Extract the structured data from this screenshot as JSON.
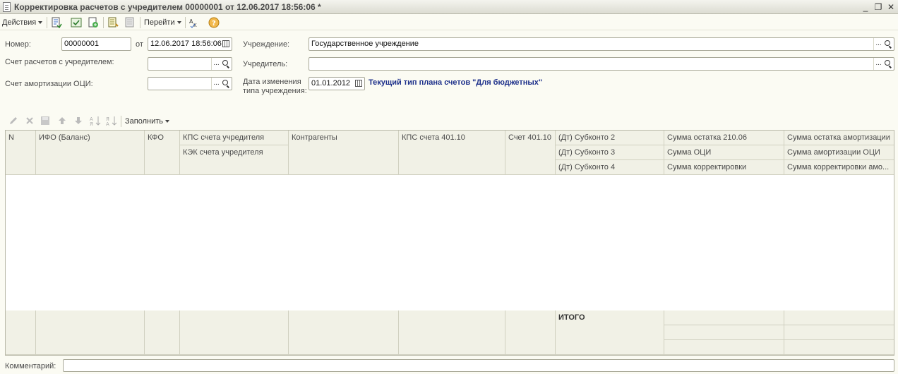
{
  "window": {
    "title": "Корректировка расчетов с учредителем 00000001 от 12.06.2017 18:56:06 *",
    "minimize_symbol": "_",
    "restore_symbol": "❐",
    "close_symbol": "✕"
  },
  "toolbar": {
    "actions_label": "Действия",
    "goto_label": "Перейти"
  },
  "form": {
    "number_label": "Номер:",
    "number_value": "00000001",
    "from_label": "от",
    "date_value": "12.06.2017 18:56:06",
    "account_label": "Счет расчетов с учредителем:",
    "account_value": "",
    "amort_label": "Счет амортизации ОЦИ:",
    "amort_value": "",
    "institution_label": "Учреждение:",
    "institution_value": "Государственное учреждение",
    "founder_label": "Учредитель:",
    "founder_value": "",
    "change_date_label_1": "Дата изменения",
    "change_date_label_2": "типа учреждения:",
    "change_date_value": "01.01.2012",
    "plan_info": "Текущий тип плана счетов \"Для бюджетных\""
  },
  "table_toolbar": {
    "fill_label": "Заполнить"
  },
  "table": {
    "headers": {
      "n": "N",
      "ifo": "ИФО (Баланс)",
      "kfo": "КФО",
      "kps_founder": "КПС счета учредителя",
      "kek_founder": "КЭК счета учредителя",
      "contractors": "Контрагенты",
      "kps_401": "КПС счета 401.10",
      "acc_401": "Счет 401.10",
      "subkonto2": "(Дт) Субконто 2",
      "subkonto3": "(Дт) Субконто 3",
      "subkonto4": "(Дт) Субконто 4",
      "sum_balance": "Сумма остатка 210.06",
      "sum_oci": "Сумма ОЦИ",
      "sum_correction": "Сумма корректировки",
      "sum_balance_amort": "Сумма остатка амортизации",
      "sum_amort_oci": "Сумма амортизации ОЦИ",
      "sum_correction_amort": "Сумма корректировки амо..."
    },
    "rows": [],
    "footer_total": "ИТОГО"
  },
  "comment": {
    "label": "Комментарий:",
    "value": ""
  },
  "colors": {
    "background": "#fbfbf3",
    "header_bg": "#f1f1e6",
    "info_text": "#1c2f8a"
  }
}
